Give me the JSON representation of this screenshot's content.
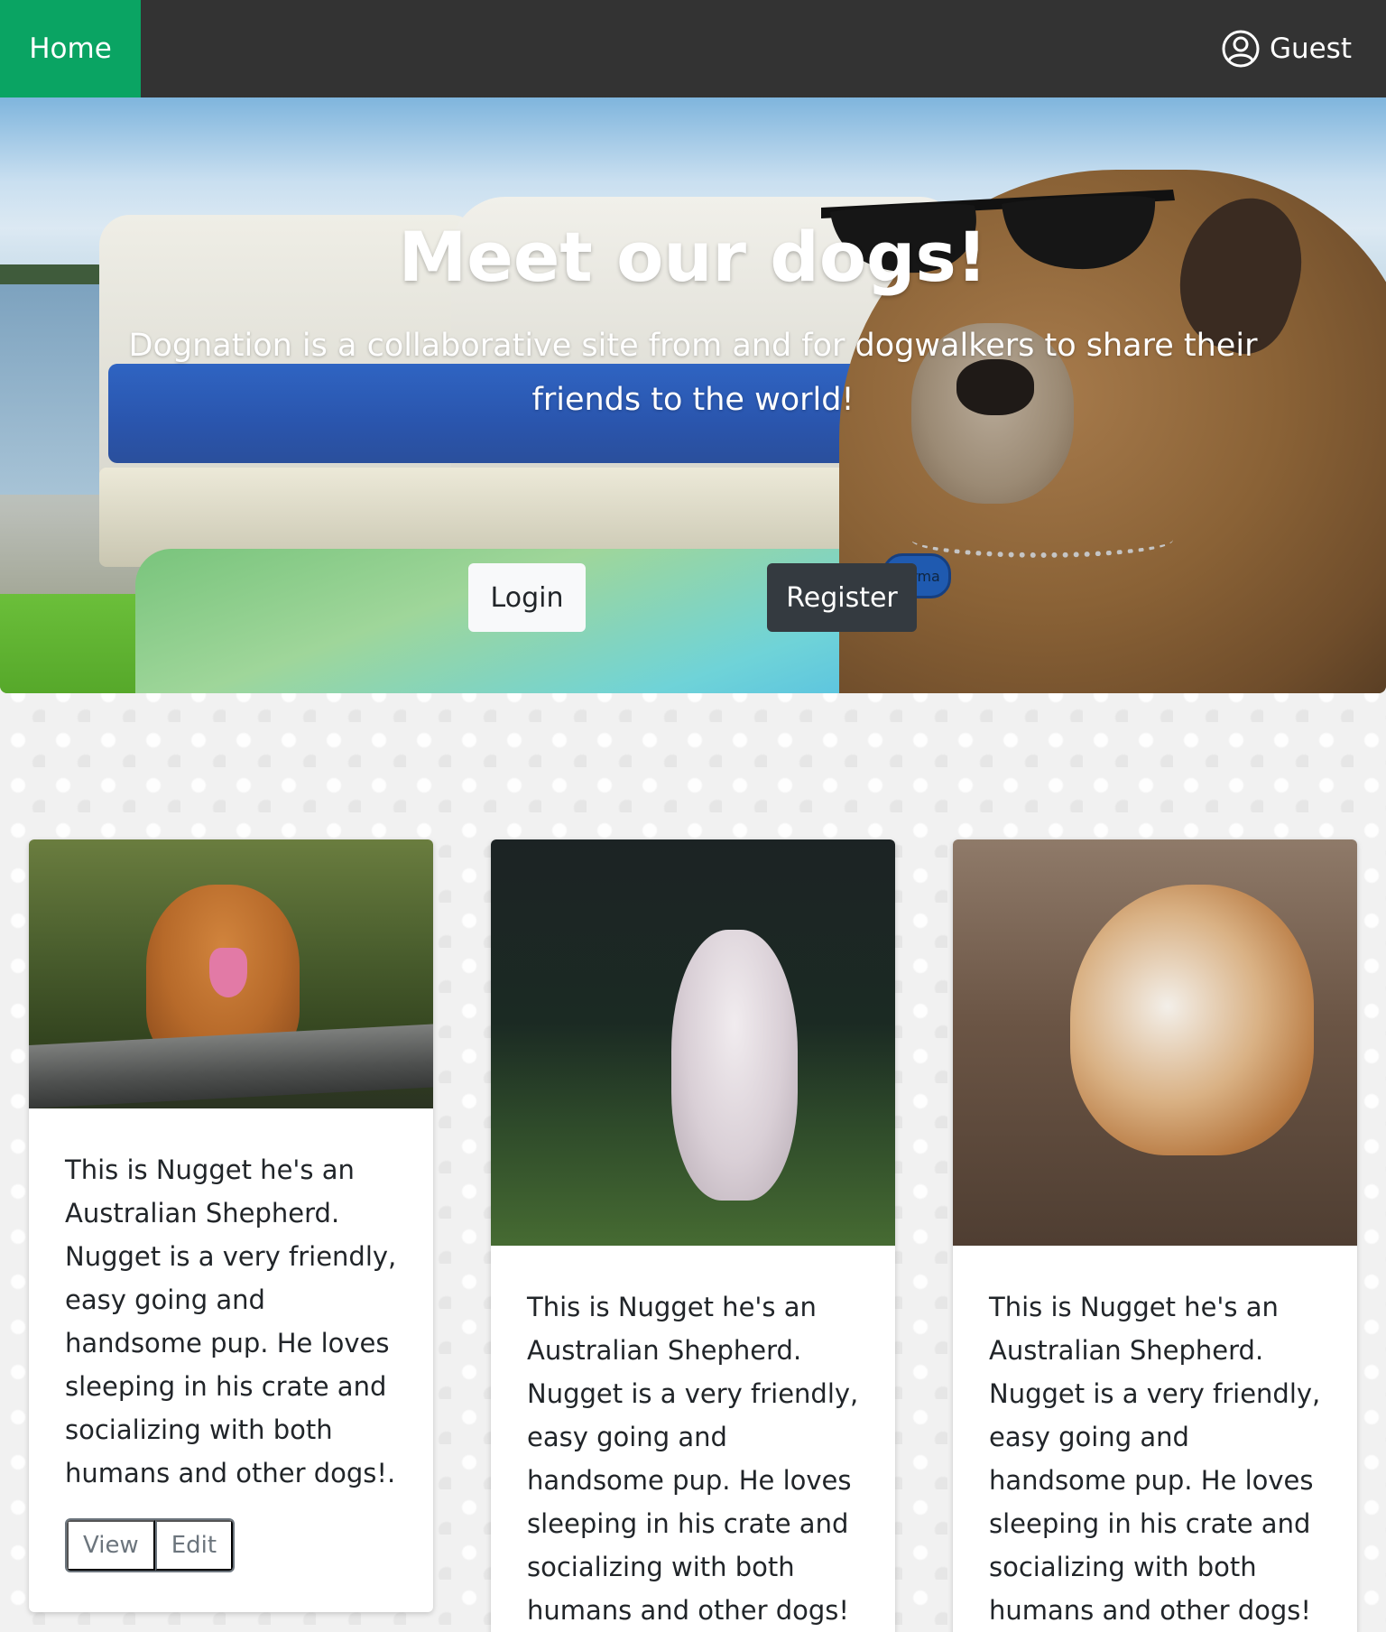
{
  "nav": {
    "home_label": "Home",
    "user_label": "Guest",
    "user_icon": "user-circle-icon",
    "accent_color": "#0aa463",
    "bar_color": "#333333"
  },
  "hero": {
    "title": "Meet our dogs!",
    "subtitle": "Dognation is a collaborative site from and for dogwalkers to share their friends to the world!",
    "login_label": "Login",
    "register_label": "Register",
    "tag_text": "Karma"
  },
  "cards": [
    {
      "image": "dog-on-log-photo",
      "text": "This is Nugget he's an Australian Shepherd. Nugget is a very friendly, easy going and handsome pup. He loves sleeping in his crate and socializing with both humans and other dogs!.",
      "view_label": "View",
      "edit_label": "Edit"
    },
    {
      "image": "white-dog-running-photo",
      "text": "This is Nugget he's an Australian Shepherd. Nugget is a very friendly, easy going and handsome pup. He loves sleeping in his crate and socializing with both humans and other dogs!"
    },
    {
      "image": "dog-on-couch-photo",
      "text": "This is Nugget he's an Australian Shepherd. Nugget is a very friendly, easy going and handsome pup. He loves sleeping in his crate and socializing with both humans and other dogs!"
    }
  ]
}
